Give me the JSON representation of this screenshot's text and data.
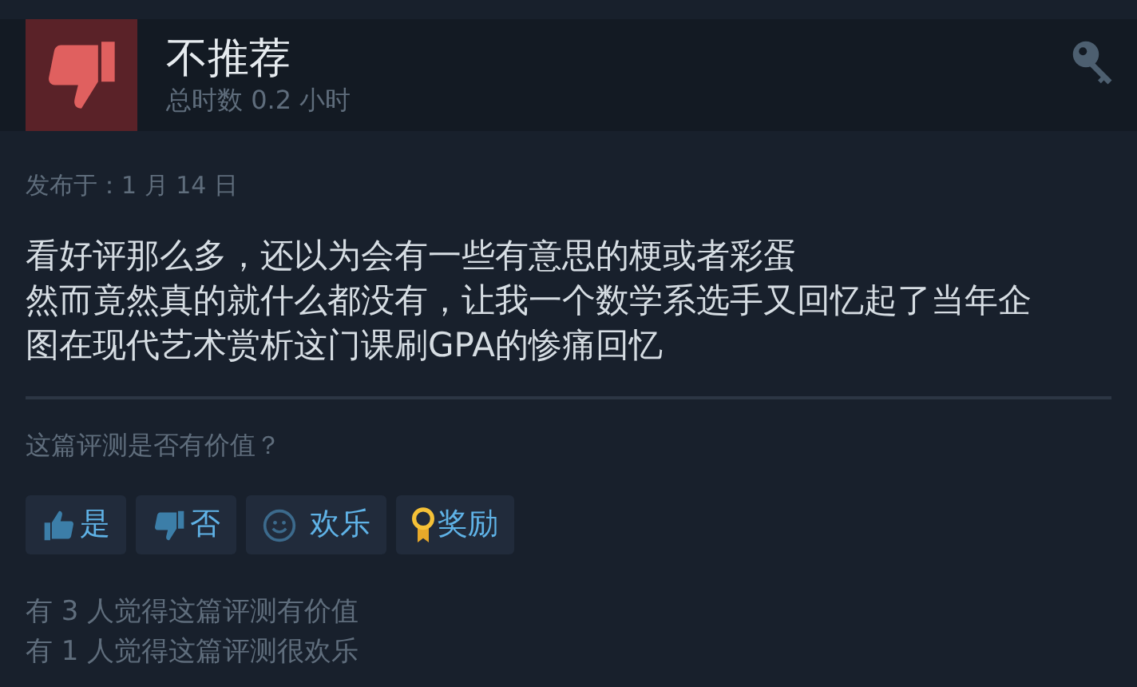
{
  "review": {
    "recommended": false,
    "verdict": "不推荐",
    "hours": "总时数 0.2 小时",
    "posted": "发布于：1 月 14 日",
    "body": [
      "看好评那么多，还以为会有一些有意思的梗或者彩蛋",
      "然而竟然真的就什么都没有，让我一个数学系选手又回忆起了当年企图在现代艺术赏析这门课刷GPA的惨痛回忆"
    ]
  },
  "helpful": {
    "question": "这篇评测是否有价值？",
    "buttons": [
      {
        "kind": "yes",
        "label": "是"
      },
      {
        "kind": "no",
        "label": "否"
      },
      {
        "kind": "funny",
        "label": "欢乐"
      },
      {
        "kind": "award",
        "label": "奖励"
      }
    ],
    "counts": [
      "有 3 人觉得这篇评测有价值",
      "有 1 人觉得这篇评测很欢乐"
    ]
  }
}
